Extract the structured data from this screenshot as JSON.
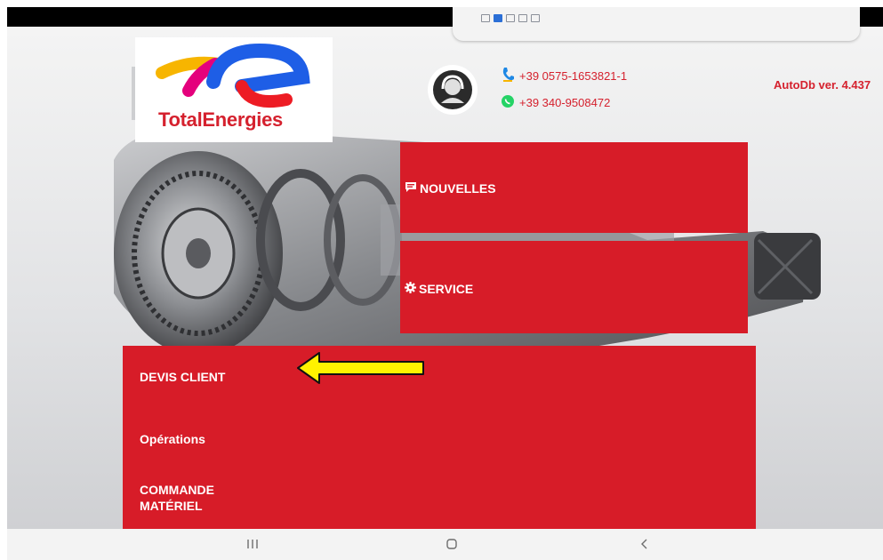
{
  "header": {
    "logo_text": "TotalEnergies",
    "phone": "+39 0575-1653821-1",
    "whatsapp": "+39 340-9508472",
    "version": "AutoDb ver. 4.437"
  },
  "tiles": {
    "nouvelles": "NOUVELLES",
    "service": "SERVICE"
  },
  "menu": {
    "devis_client": "DEVIS CLIENT",
    "operations": "Opérations",
    "commande_line1": "COMMANDE",
    "commande_line2": "MATÉRIEL"
  },
  "icons": {
    "support_avatar": "headset-support-icon",
    "phone": "phone-icon",
    "whatsapp": "whatsapp-icon",
    "nouvelles": "message-icon",
    "service": "gear-icon",
    "annotation": "arrow-left-icon",
    "nav_recents": "recent-apps-icon",
    "nav_home": "home-icon",
    "nav_back": "back-icon"
  },
  "colors": {
    "brand_red": "#d71c28",
    "text_red": "#d5212e",
    "annotation_yellow": "#fff200",
    "whatsapp_green": "#25d366",
    "phone_blue": "#1e88e5"
  }
}
